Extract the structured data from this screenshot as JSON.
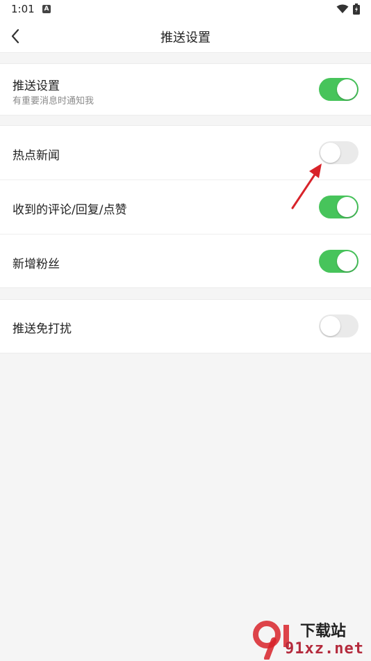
{
  "status_bar": {
    "time": "1:01",
    "icon_a": "A",
    "wifi_icon": "wifi-icon",
    "battery_icon": "battery-icon"
  },
  "header": {
    "title": "推送设置",
    "back_icon": "chevron-left-icon"
  },
  "settings": {
    "push": {
      "title": "推送设置",
      "subtitle": "有重要消息时通知我",
      "enabled": true
    },
    "hot_news": {
      "title": "热点新闻",
      "enabled": false
    },
    "comments": {
      "title": "收到的评论/回复/点赞",
      "enabled": true
    },
    "new_fans": {
      "title": "新增粉丝",
      "enabled": true
    },
    "dnd": {
      "title": "推送免打扰",
      "enabled": false
    }
  },
  "colors": {
    "toggle_on": "#47c45b",
    "toggle_off": "#eaeaea",
    "arrow": "#d8232a"
  },
  "watermark": {
    "text": "91xz.net",
    "lettering": "9下载站"
  }
}
